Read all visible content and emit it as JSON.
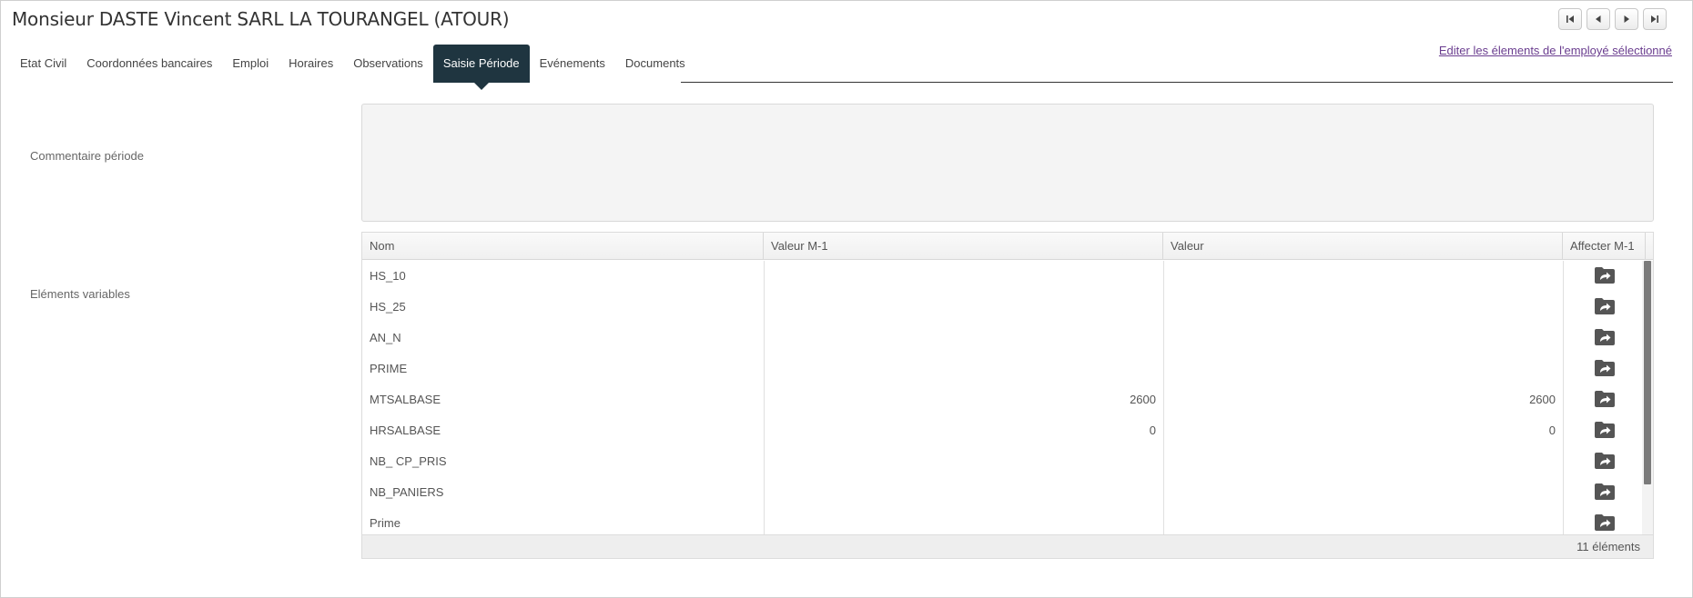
{
  "header": {
    "title": "Monsieur DASTE Vincent SARL LA TOURANGEL (ATOUR)",
    "edit_link": "Editer les élements de l'employé sélectionné",
    "nav_buttons": [
      {
        "name": "first-record",
        "icon": "skip-first-icon"
      },
      {
        "name": "previous-record",
        "icon": "previous-icon"
      },
      {
        "name": "next-record",
        "icon": "next-icon"
      },
      {
        "name": "last-record",
        "icon": "skip-last-icon"
      }
    ]
  },
  "tabs": [
    {
      "label": "Etat Civil",
      "active": false
    },
    {
      "label": "Coordonnées bancaires",
      "active": false
    },
    {
      "label": "Emploi",
      "active": false
    },
    {
      "label": "Horaires",
      "active": false
    },
    {
      "label": "Observations",
      "active": false
    },
    {
      "label": "Saisie Période",
      "active": true
    },
    {
      "label": "Evénements",
      "active": false
    },
    {
      "label": "Documents",
      "active": false
    }
  ],
  "form": {
    "comment_label": "Commentaire période",
    "comment_value": "",
    "variables_label": "Eléments variables"
  },
  "grid": {
    "columns": [
      "Nom",
      "Valeur M-1",
      "Valeur",
      "Affecter M-1"
    ],
    "rows": [
      {
        "nom": "HS_10",
        "valeur_m1": "",
        "valeur": ""
      },
      {
        "nom": "HS_25",
        "valeur_m1": "",
        "valeur": ""
      },
      {
        "nom": "AN_N",
        "valeur_m1": "",
        "valeur": ""
      },
      {
        "nom": "PRIME",
        "valeur_m1": "",
        "valeur": ""
      },
      {
        "nom": "MTSALBASE",
        "valeur_m1": "2600",
        "valeur": "2600"
      },
      {
        "nom": "HRSALBASE",
        "valeur_m1": "0",
        "valeur": "0"
      },
      {
        "nom": "NB_ CP_PRIS",
        "valeur_m1": "",
        "valeur": ""
      },
      {
        "nom": "NB_PANIERS",
        "valeur_m1": "",
        "valeur": ""
      },
      {
        "nom": "Prime",
        "valeur_m1": "",
        "valeur": ""
      }
    ],
    "action_icon": "folder-share-icon",
    "footer_count": "11 éléments"
  },
  "colors": {
    "active_tab": "#1f3540",
    "link": "#6a3d8f",
    "action_icon": "#555555"
  }
}
